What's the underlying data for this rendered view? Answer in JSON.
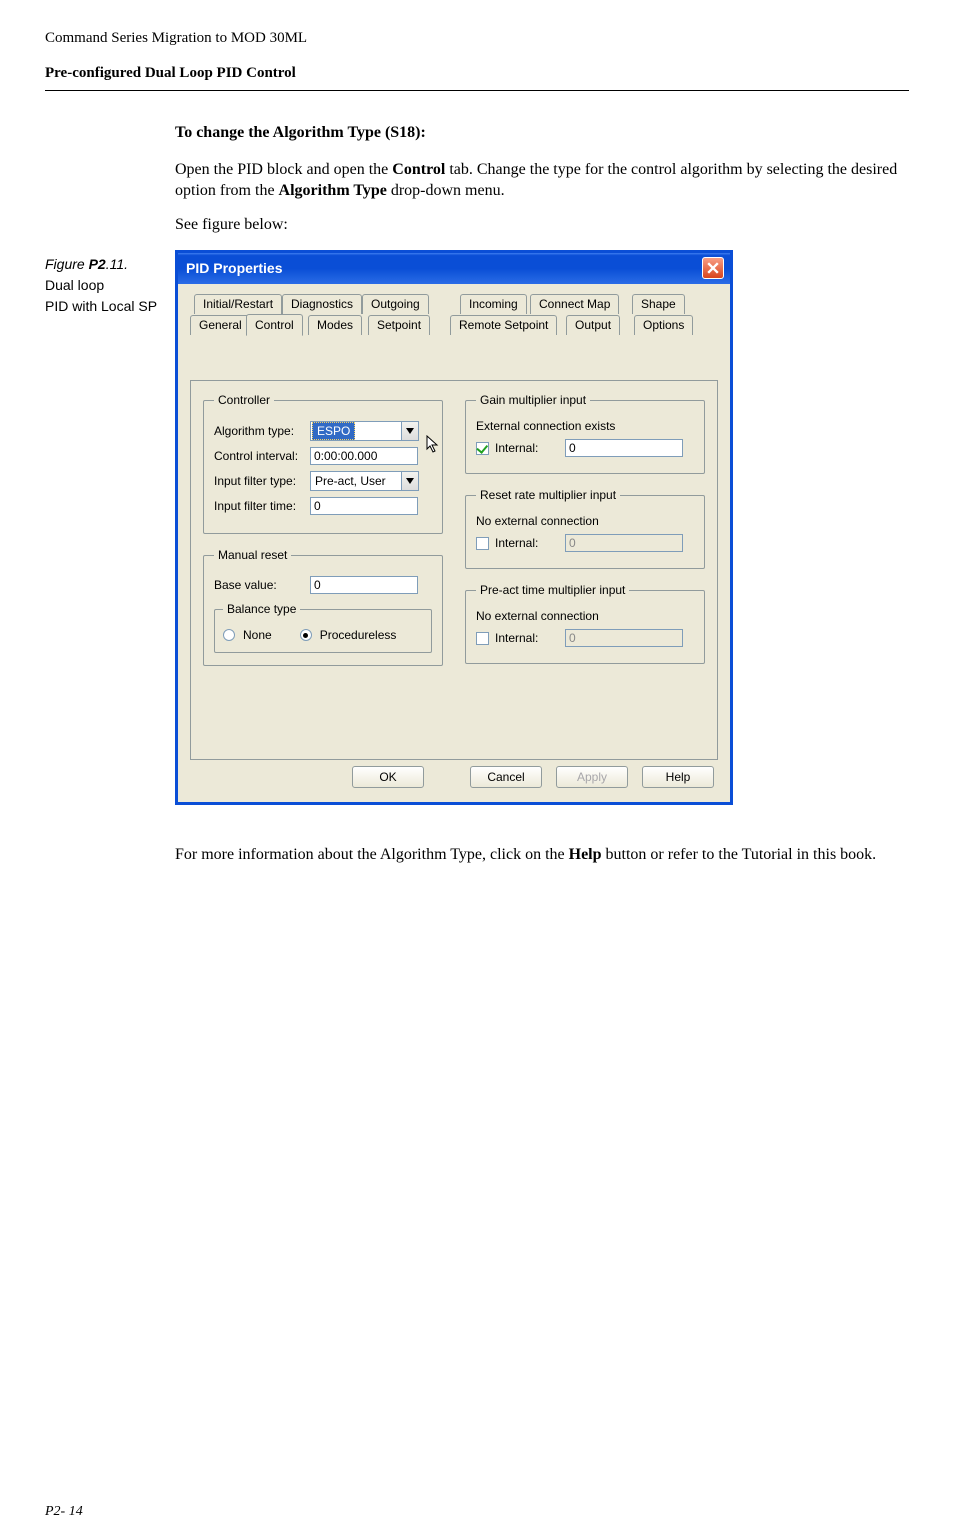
{
  "doc": {
    "header": "Command Series Migration to MOD 30ML",
    "subheader": "Pre-configured Dual Loop PID Control",
    "heading": "To change the Algorithm Type (S18):",
    "para1a": "Open the PID block and open the ",
    "para1b": "Control",
    "para1c": " tab. Change the type for the control algorithm by selecting the desired option from the ",
    "para1d": "Algorithm Type",
    "para1e": " drop-down menu.",
    "para2": "See figure below:",
    "figprefix": "Figure ",
    "fignum": "P2",
    "figrest": ".11.",
    "figcap1": "Dual loop",
    "figcap2": "PID with Local SP",
    "para3a": "For more information about the Algorithm Type, click on the ",
    "para3b": "Help",
    "para3c": " button or refer to the Tutorial in this book.",
    "pagenum": "P2- 14"
  },
  "dialog": {
    "title": "PID Properties",
    "tabs_back": [
      "Initial/Restart",
      "Diagnostics",
      "Outgoing",
      "Incoming",
      "Connect Map",
      "Shape"
    ],
    "tabs_front": [
      "General",
      "Control",
      "Modes",
      "Setpoint",
      "Remote Setpoint",
      "Output",
      "Options"
    ],
    "active_tab": "Control",
    "controller": {
      "legend": "Controller",
      "algorithm_type_label": "Algorithm type:",
      "algorithm_type_value": "ESPO",
      "control_interval_label": "Control interval:",
      "control_interval_value": "0:00:00.000",
      "input_filter_type_label": "Input filter type:",
      "input_filter_type_value": "Pre-act, User",
      "input_filter_time_label": "Input filter time:",
      "input_filter_time_value": "0"
    },
    "manual_reset": {
      "legend": "Manual reset",
      "base_value_label": "Base value:",
      "base_value": "0",
      "balance_legend": "Balance type",
      "opt_none": "None",
      "opt_procedureless": "Procedureless",
      "selected": "Procedureless"
    },
    "gain": {
      "legend": "Gain multiplier input",
      "status": "External connection exists",
      "internal_label": "Internal:",
      "internal_checked": true,
      "internal_value": "0"
    },
    "reset_rate": {
      "legend": "Reset rate multiplier input",
      "status": "No external connection",
      "internal_label": "Internal:",
      "internal_checked": false,
      "internal_value": "0"
    },
    "preact": {
      "legend": "Pre-act time multiplier input",
      "status": "No external connection",
      "internal_label": "Internal:",
      "internal_checked": false,
      "internal_value": "0"
    },
    "buttons": {
      "ok": "OK",
      "cancel": "Cancel",
      "apply": "Apply",
      "help": "Help"
    }
  }
}
